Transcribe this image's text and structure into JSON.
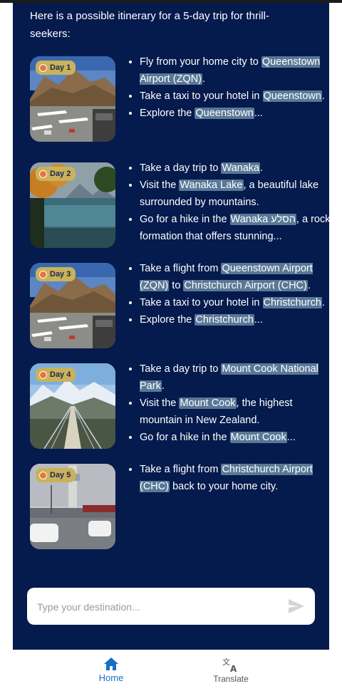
{
  "intro": "Here is a possible itinerary for a 5-day trip for thrill-seekers:",
  "days": [
    {
      "badge": "Day 1",
      "image": "queenstown-airport-photo",
      "bullets": [
        [
          "Fly from your home city to ",
          {
            "hl": "Queenstown Airport (ZQN)"
          },
          "."
        ],
        [
          "Take a taxi to your hotel in ",
          {
            "hl": "Queenstown"
          },
          "."
        ],
        [
          "Explore the ",
          {
            "hl": "Queenstown"
          },
          "..."
        ]
      ]
    },
    {
      "badge": "Day 2",
      "image": "wanaka-lake-photo",
      "bullets": [
        [
          "Take a day trip to ",
          {
            "hl": "Wanaka"
          },
          "."
        ],
        [
          "Visit the ",
          {
            "hl": "Wanaka Lake"
          },
          ", a beautiful lake surrounded by mountains."
        ],
        [
          "Go for a hike in the ",
          {
            "hl": "Wanaka הסלע"
          },
          ", a rock formation that offers stunning..."
        ]
      ]
    },
    {
      "badge": "Day 3",
      "image": "queenstown-airport-photo",
      "bullets": [
        [
          "Take a flight from ",
          {
            "hl": "Queenstown Airport (ZQN)"
          },
          " to ",
          {
            "hl": "Christchurch Airport (CHC)"
          },
          "."
        ],
        [
          "Take a taxi to your hotel in ",
          {
            "hl": "Christchurch"
          },
          "."
        ],
        [
          "Explore the ",
          {
            "hl": "Christchurch"
          },
          "..."
        ]
      ]
    },
    {
      "badge": "Day 4",
      "image": "mount-cook-bridge-photo",
      "bullets": [
        [
          "Take a day trip to ",
          {
            "hl": "Mount Cook National Park"
          },
          "."
        ],
        [
          "Visit the ",
          {
            "hl": "Mount Cook"
          },
          ", the highest mountain in New Zealand."
        ],
        [
          "Go for a hike in the ",
          {
            "hl": "Mount Cook"
          },
          "..."
        ]
      ]
    },
    {
      "badge": "Day 5",
      "image": "christchurch-airport-photo",
      "bullets": [
        [
          "Take a flight from ",
          {
            "hl": "Christchurch Airport (CHC)"
          },
          " back to your home city."
        ]
      ]
    }
  ],
  "input": {
    "placeholder": "Type your destination..."
  },
  "nav": {
    "home": "Home",
    "translate": "Translate"
  },
  "colors": {
    "panel": "#051a4d",
    "highlight": "#5a7896",
    "badge": "#c9b25a",
    "accent": "#1a6fc4"
  }
}
